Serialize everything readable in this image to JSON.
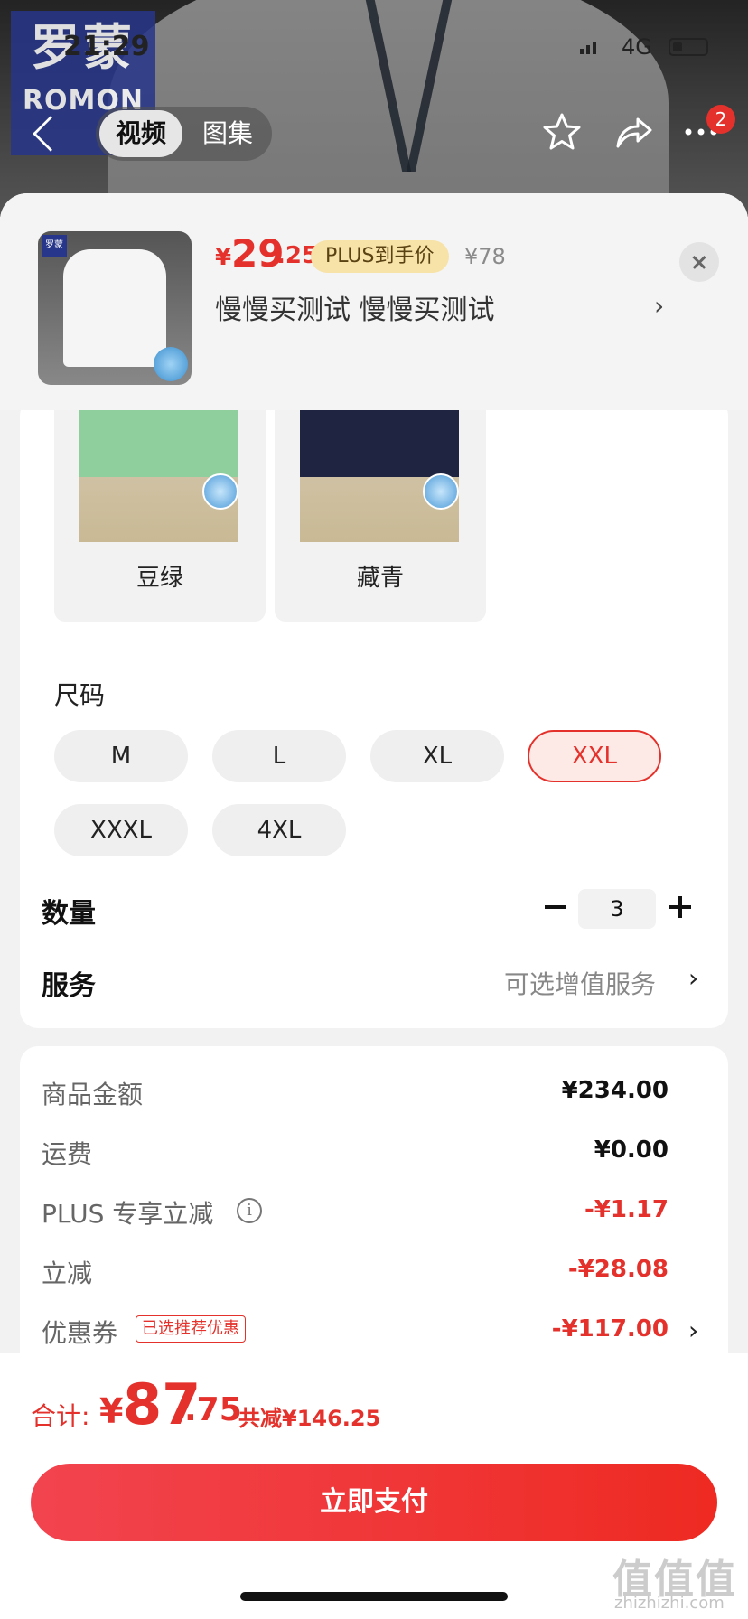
{
  "status_bar": {
    "time": "21:29",
    "network": "4G"
  },
  "brand": {
    "logo_cn": "罗蒙",
    "logo_en": "ROMON"
  },
  "header": {
    "tabs": [
      {
        "label": "视频",
        "active": true
      },
      {
        "label": "图集",
        "active": false
      }
    ],
    "icons": [
      "back-icon",
      "star-icon",
      "share-icon",
      "more-icon"
    ],
    "notification_count": "2"
  },
  "product": {
    "currency": "¥",
    "price_int": "29",
    "price_dec": ".25",
    "plus_badge": "PLUS到手价",
    "original_price": "¥78",
    "title": "慢慢买测试  慢慢买测试"
  },
  "colors": {
    "options": [
      {
        "label": "豆绿",
        "swatch": "#8fcf9e"
      },
      {
        "label": "藏青",
        "swatch": "#1f2540"
      }
    ]
  },
  "size": {
    "title": "尺码",
    "options": [
      "M",
      "L",
      "XL",
      "XXL",
      "XXXL",
      "4XL"
    ],
    "selected": "XXL"
  },
  "quantity": {
    "label": "数量",
    "value": "3"
  },
  "service": {
    "label": "服务",
    "value": "可选增值服务"
  },
  "costs": [
    {
      "label": "商品金额",
      "value": "¥234.00",
      "color": "#111111"
    },
    {
      "label": "运费",
      "value": "¥0.00",
      "color": "#111111"
    },
    {
      "label": "PLUS 专享立减",
      "value": "-¥1.17",
      "color": "#e4312b"
    },
    {
      "label": "立减",
      "value": "-¥28.08",
      "color": "#e4312b"
    },
    {
      "label": "优惠券",
      "value": "-¥117.00",
      "color": "#e4312b"
    }
  ],
  "coupon_tag": "已选推荐优惠",
  "total": {
    "label": "合计:",
    "currency": "¥",
    "int": "87",
    "dec": ".75",
    "saved": "共减¥146.25"
  },
  "pay_button": "立即支付",
  "watermark": {
    "main": "值值值",
    "sub": "zhizhizhi.com"
  },
  "accent_color": "#e4312b"
}
